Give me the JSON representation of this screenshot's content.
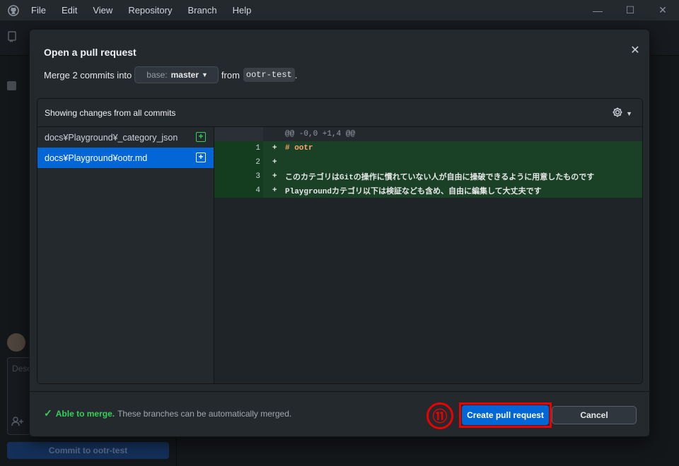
{
  "menu": [
    "File",
    "Edit",
    "View",
    "Repository",
    "Branch",
    "Help"
  ],
  "window_controls": {
    "minimize": "—",
    "maximize": "☐",
    "close": "✕"
  },
  "background": {
    "description_placeholder": "Desc",
    "commit_button": "Commit to ootr-test"
  },
  "dialog": {
    "title": "Open a pull request",
    "close_glyph": "✕",
    "merge_prefix": "Merge 2 commits into",
    "base_prefix": "base:",
    "base_branch": "master",
    "from_text": "from",
    "compare_branch": "ootr-test",
    "period": ".",
    "changes_header": "Showing changes from all commits",
    "files": [
      {
        "name": "docs¥Playground¥_category_json",
        "status": "+"
      },
      {
        "name": "docs¥Playground¥ootr.md",
        "status": "+"
      }
    ],
    "diff": {
      "hunk": "@@ -0,0 +1,4 @@",
      "lines": [
        {
          "num": "1",
          "sign": "+",
          "text": "# ootr"
        },
        {
          "num": "2",
          "sign": "+",
          "text": ""
        },
        {
          "num": "3",
          "sign": "+",
          "text": "このカテゴリはGitの操作に慣れていない人が自由に操破できるように用意したものです"
        },
        {
          "num": "4",
          "sign": "+",
          "text": "Playgroundカテゴリ以下は検証なども含め、自由に編集して大丈夫です"
        }
      ]
    },
    "merge_ok_label": "Able to merge.",
    "merge_ok_desc": "These branches can be automatically merged.",
    "step_marker": "⑪",
    "create_button": "Create pull request",
    "cancel_button": "Cancel"
  },
  "colors": {
    "accent_blue": "#0366d6",
    "success_green": "#34d058",
    "annotation_red": "#ee0000"
  }
}
